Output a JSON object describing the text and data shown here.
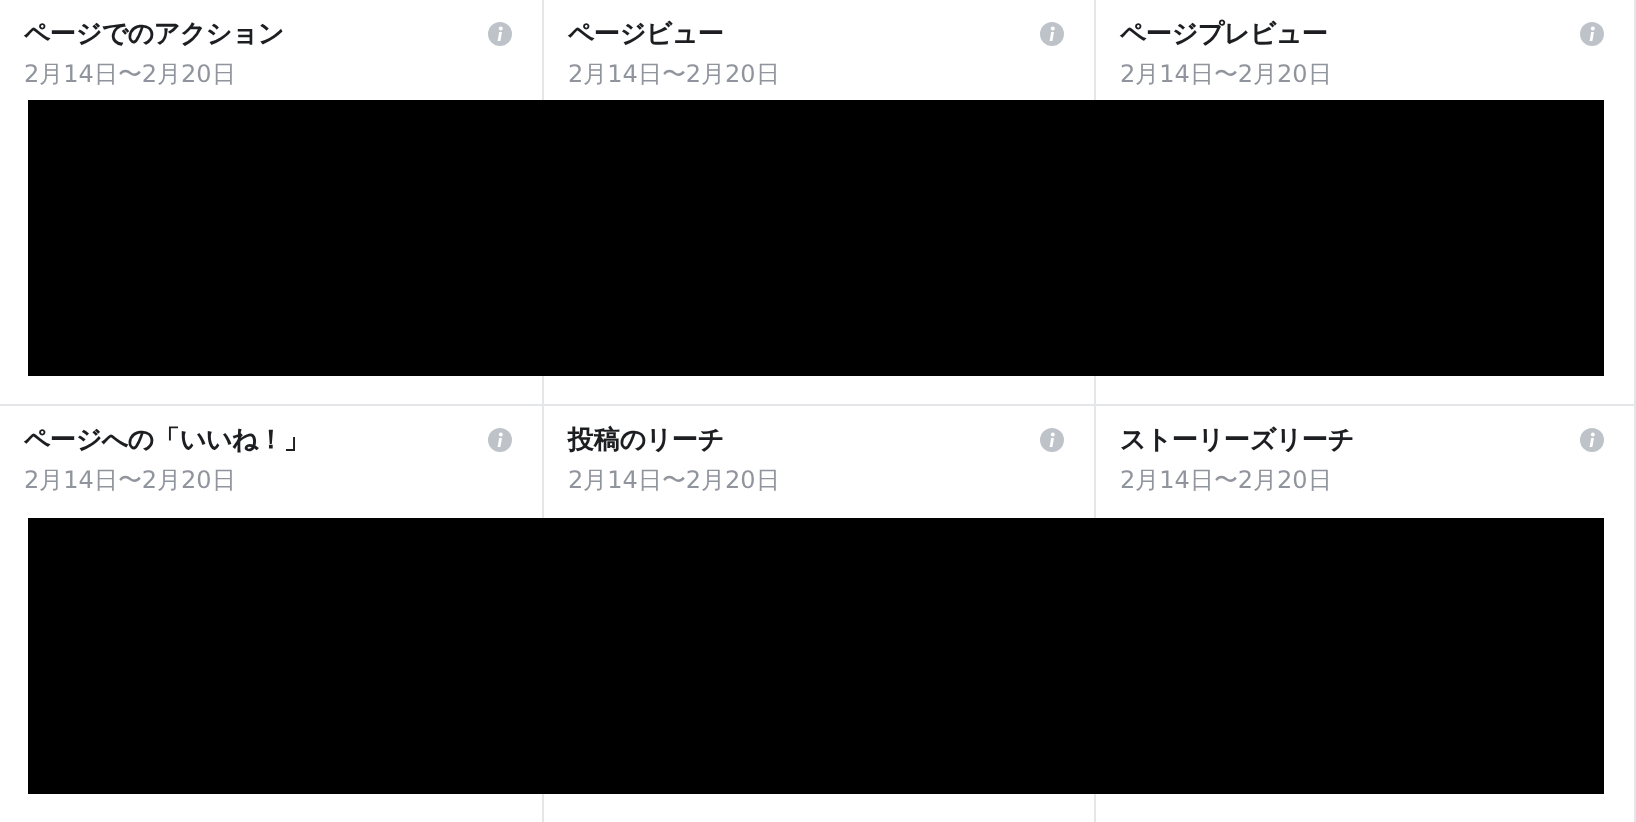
{
  "rows": [
    {
      "redacted": true,
      "cards": [
        {
          "title": "ページでのアクション",
          "date": "2月14日〜2月20日"
        },
        {
          "title": "ページビュー",
          "date": "2月14日〜2月20日"
        },
        {
          "title": "ページプレビュー",
          "date": "2月14日〜2月20日"
        }
      ]
    },
    {
      "redacted": true,
      "cards": [
        {
          "title": "ページへの「いいね！」",
          "date": "2月14日〜2月20日"
        },
        {
          "title": "投稿のリーチ",
          "date": "2月14日〜2月20日"
        },
        {
          "title": "ストーリーズリーチ",
          "date": "2月14日〜2月20日"
        }
      ]
    }
  ]
}
